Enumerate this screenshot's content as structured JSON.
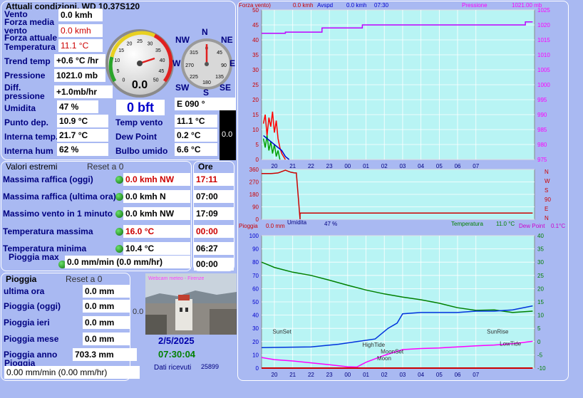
{
  "current": {
    "title": "Attuali condizioni, WD 10.37S120",
    "wind_label": "Vento",
    "wind_value": "0.0 kmh",
    "avg_wind_label": "Forza media vento",
    "avg_wind_value": "0.0 kmh",
    "gust_label": "Forza attuale",
    "temp_label": "Temperatura",
    "temp_value": "11.1 °C",
    "trend_label": "Trend temp",
    "trend_value": "+0.6 °C /hr",
    "pressure_label": "Pressione",
    "pressure_value": "1021.0 mb",
    "diff_pressure_label": "Diff. pressione",
    "diff_pressure_value": "+1.0mb/hr",
    "humidity_label": "Umidita",
    "humidity_value": "47 %",
    "dew_label": "Punto dep.",
    "dew_value": "10.9 °C",
    "int_temp_label": "Interna temp.",
    "int_temp_value": "21.7 °C",
    "int_hum_label": "Interna hum",
    "int_hum_value": "62 %",
    "windchill_label": "Temp vento",
    "windchill_value": "11.1 °C",
    "dewpoint_label": "Dew Point",
    "dewpoint_value": "0.2 °C",
    "wetbulb_label": "Bulbo umido",
    "wetbulb_value": "6.6 °C",
    "bft_value": "0 bft",
    "direction_value": "E  090 °",
    "black_box_value": "0.0",
    "gauge_value": "0.0",
    "gauge_ticks": [
      "0",
      "5",
      "10",
      "15",
      "20",
      "25",
      "30",
      "35",
      "40",
      "45",
      "50"
    ],
    "compass_labels": {
      "n": "N",
      "ne": "NE",
      "e": "E",
      "se": "SE",
      "s": "S",
      "sw": "SW",
      "w": "W",
      "nw": "NW"
    },
    "compass_degrees": [
      "315",
      "0",
      "45",
      "270",
      "90",
      "225",
      "135",
      "180"
    ]
  },
  "extremes": {
    "title": "Valori estremi",
    "reset": "Reset a 0",
    "times_title": "Ore",
    "rows": [
      {
        "label": "Massima raffica (oggi)",
        "value": "0.0 kmh  NW",
        "time": "17:11",
        "red": true
      },
      {
        "label": "Massima raffica (ultima ora)",
        "value": "0.0 kmh  N",
        "time": "07:00",
        "red": false
      },
      {
        "label": "Massimo vento in 1 minuto",
        "value": "0.0 kmh  NW",
        "time": "17:09",
        "red": false
      },
      {
        "label": "Temperatura massima",
        "value": "16.0 °C",
        "time": "00:00",
        "red": true
      },
      {
        "label": "Temperatura minima",
        "value": "10.4 °C",
        "time": "06:27",
        "red": false
      },
      {
        "label": "Pioggia max",
        "value": "0.0 mm/min (0.0 mm/hr)",
        "time": "00:00",
        "red": false
      }
    ]
  },
  "rain": {
    "title": "Pioggia",
    "reset": "Reset a 0",
    "rows": [
      {
        "label": "ultima ora",
        "value": "0.0 mm"
      },
      {
        "label": "Pioggia (oggi)",
        "value": "0.0 mm"
      },
      {
        "label": "Pioggia ieri",
        "value": "0.0 mm"
      },
      {
        "label": "Pioggia mese",
        "value": "0.0 mm"
      },
      {
        "label": "Pioggia anno",
        "value": "703.3 mm"
      }
    ],
    "rate_label": "Pioggia",
    "rate_value": "0.00 mm/min (0.00 mm/hr)",
    "side_value": "0.0",
    "date": "2/5/2025",
    "time": "07:30:04",
    "received_label": "Dati ricevuti",
    "received_value": "25899",
    "webcam_caption": "Webcam meteo - Firenze"
  },
  "colors": {
    "panel_bg": "#a9b9f2",
    "plot_bg": "#b8f4f4",
    "red": "#cc0000",
    "magenta": "#ff00ff",
    "blue": "#0000cc",
    "green": "#008000"
  },
  "chart_data": [
    {
      "type": "line",
      "title": "",
      "header_left": "Forza vento)",
      "header_wind": "0.0 kmh",
      "header_avspd": "Avspd",
      "header_avspd_value": "0.0 kmh",
      "header_time": "07:30",
      "header_pressure": "Pressione",
      "header_pressure_value": "1021.00 mb",
      "x_ticks": [
        "20",
        "21",
        "22",
        "23",
        "00",
        "01",
        "02",
        "03",
        "04",
        "05",
        "06",
        "07"
      ],
      "y_left": {
        "min": 0,
        "max": 50,
        "ticks": [
          "0",
          "5",
          "10",
          "15",
          "20",
          "25",
          "30",
          "35",
          "40",
          "45",
          "50"
        ]
      },
      "y_right": {
        "min": 975,
        "max": 1025,
        "ticks": [
          "975",
          "980",
          "985",
          "990",
          "995",
          "1000",
          "1005",
          "1010",
          "1015",
          "1020",
          "1025"
        ]
      },
      "series": [
        {
          "key": "pressure",
          "axis": "right",
          "color": "#c000ff",
          "x": [
            19.3,
            20.6,
            20.6,
            22.6,
            22.6,
            24.8,
            24.8,
            33.7,
            33.7,
            34.1
          ],
          "y": [
            1017.2,
            1017.2,
            1017.6,
            1017.6,
            1019.0,
            1019.0,
            1020.0,
            1020.0,
            1021.0,
            1021.0
          ]
        },
        {
          "key": "gust",
          "axis": "left",
          "color": "#ff0000",
          "x": [
            19.4,
            19.5,
            19.6,
            19.7,
            19.8,
            19.9,
            20.0,
            20.1,
            20.2,
            20.3,
            20.4,
            20.5,
            20.6
          ],
          "y": [
            12,
            15,
            8,
            14,
            11,
            16,
            9,
            13,
            7,
            4,
            2,
            1,
            0
          ]
        },
        {
          "key": "avg",
          "axis": "left",
          "color": "#00a000",
          "x": [
            19.4,
            19.5,
            19.6,
            19.7,
            19.8,
            19.9,
            20.0,
            20.1,
            20.2,
            20.3
          ],
          "y": [
            7,
            4,
            8,
            3,
            6,
            2,
            5,
            1,
            3,
            0
          ]
        },
        {
          "key": "avspd",
          "axis": "left",
          "color": "#0000cc",
          "x": [
            19.4,
            19.6,
            19.8,
            20.0,
            20.2,
            20.4,
            20.6,
            20.8
          ],
          "y": [
            8,
            7,
            6,
            5,
            4,
            3,
            1,
            0
          ]
        }
      ]
    },
    {
      "type": "line",
      "title": "",
      "y_left": {
        "ticks": [
          "0",
          "90",
          "180",
          "270",
          "360"
        ]
      },
      "y_right_labels": [
        "N",
        "W",
        "S",
        "90",
        "E",
        "N"
      ],
      "series": [
        {
          "key": "direction",
          "color": "#cc0000",
          "x": [
            19.3,
            19.8,
            20.2,
            20.6,
            20.9,
            21.1,
            21.2,
            21.4,
            21.4,
            34.1
          ],
          "y": [
            330,
            330,
            335,
            355,
            340,
            335,
            335,
            0,
            45,
            45
          ]
        }
      ]
    },
    {
      "type": "line",
      "title": "",
      "header_rain": "Pioggia",
      "header_rain_value": "0.0 mm",
      "header_hum": "Umidita",
      "header_hum_value": "47 %",
      "header_temp": "Temperatura",
      "header_temp_value": "11.0 °C",
      "header_dew": "Dew Point",
      "header_dew_value": "0.1°C",
      "x_ticks": [
        "20",
        "21",
        "22",
        "23",
        "00",
        "01",
        "02",
        "03",
        "04",
        "05",
        "06",
        "07"
      ],
      "y_left": {
        "min": 0,
        "max": 100,
        "ticks": [
          "0",
          "10",
          "20",
          "30",
          "40",
          "50",
          "60",
          "70",
          "80",
          "90",
          "100"
        ]
      },
      "y_right": {
        "min": -10,
        "max": 40,
        "ticks": [
          "-10",
          "-5",
          "0",
          "5",
          "10",
          "15",
          "20",
          "25",
          "30",
          "35",
          "40"
        ]
      },
      "annotations": [
        {
          "text": "SunSet",
          "x": 19.9,
          "y": 3
        },
        {
          "text": "HighTide",
          "x": 24.8,
          "y": -2
        },
        {
          "text": "MoonSet",
          "x": 25.8,
          "y": -4.5
        },
        {
          "text": "Moon",
          "x": 25.6,
          "y": -7
        },
        {
          "text": "SunRise",
          "x": 31.6,
          "y": 3
        },
        {
          "text": "LowTide",
          "x": 32.3,
          "y": -1.5
        }
      ],
      "series": [
        {
          "key": "temperature",
          "axis": "right",
          "color": "#008000",
          "x": [
            19.3,
            20.0,
            21.0,
            22.0,
            23.0,
            24.0,
            25.0,
            26.0,
            27.0,
            28.0,
            29.0,
            30.0,
            31.0,
            32.0,
            33.0,
            34.1
          ],
          "y": [
            30.0,
            28.0,
            26.2,
            25.0,
            23.2,
            21.3,
            19.5,
            18.0,
            16.8,
            15.8,
            14.5,
            12.8,
            11.8,
            12.0,
            11.0,
            11.5
          ]
        },
        {
          "key": "humidity",
          "axis": "left",
          "color": "#0033dd",
          "x": [
            19.3,
            22.0,
            23.5,
            24.5,
            25.5,
            26.2,
            26.7,
            27.0,
            28.0,
            29.0,
            30.0,
            31.0,
            32.0,
            33.0,
            34.1
          ],
          "y": [
            15.5,
            16,
            18,
            20,
            22,
            30,
            34,
            41,
            42,
            42,
            42,
            43,
            43,
            44,
            47
          ]
        },
        {
          "key": "dewpoint",
          "axis": "right",
          "color": "#ff00ff",
          "x": [
            19.3,
            20.0,
            21.0,
            22.0,
            23.0,
            24.0,
            24.5,
            25.0,
            26.0,
            27.0,
            28.0,
            29.0,
            30.0,
            31.0,
            32.0,
            33.0,
            34.1
          ],
          "y": [
            -6.0,
            -6.8,
            -7.3,
            -8.0,
            -8.7,
            -9.5,
            -9.6,
            -7.8,
            -5.2,
            -3.0,
            -2.6,
            -2.4,
            -2.0,
            -1.6,
            -1.3,
            -0.8,
            0.1
          ]
        },
        {
          "key": "rain",
          "axis": "right",
          "color": "#cc0000",
          "x": [
            19.3,
            34.1
          ],
          "y": [
            -10,
            -10
          ]
        }
      ]
    }
  ]
}
